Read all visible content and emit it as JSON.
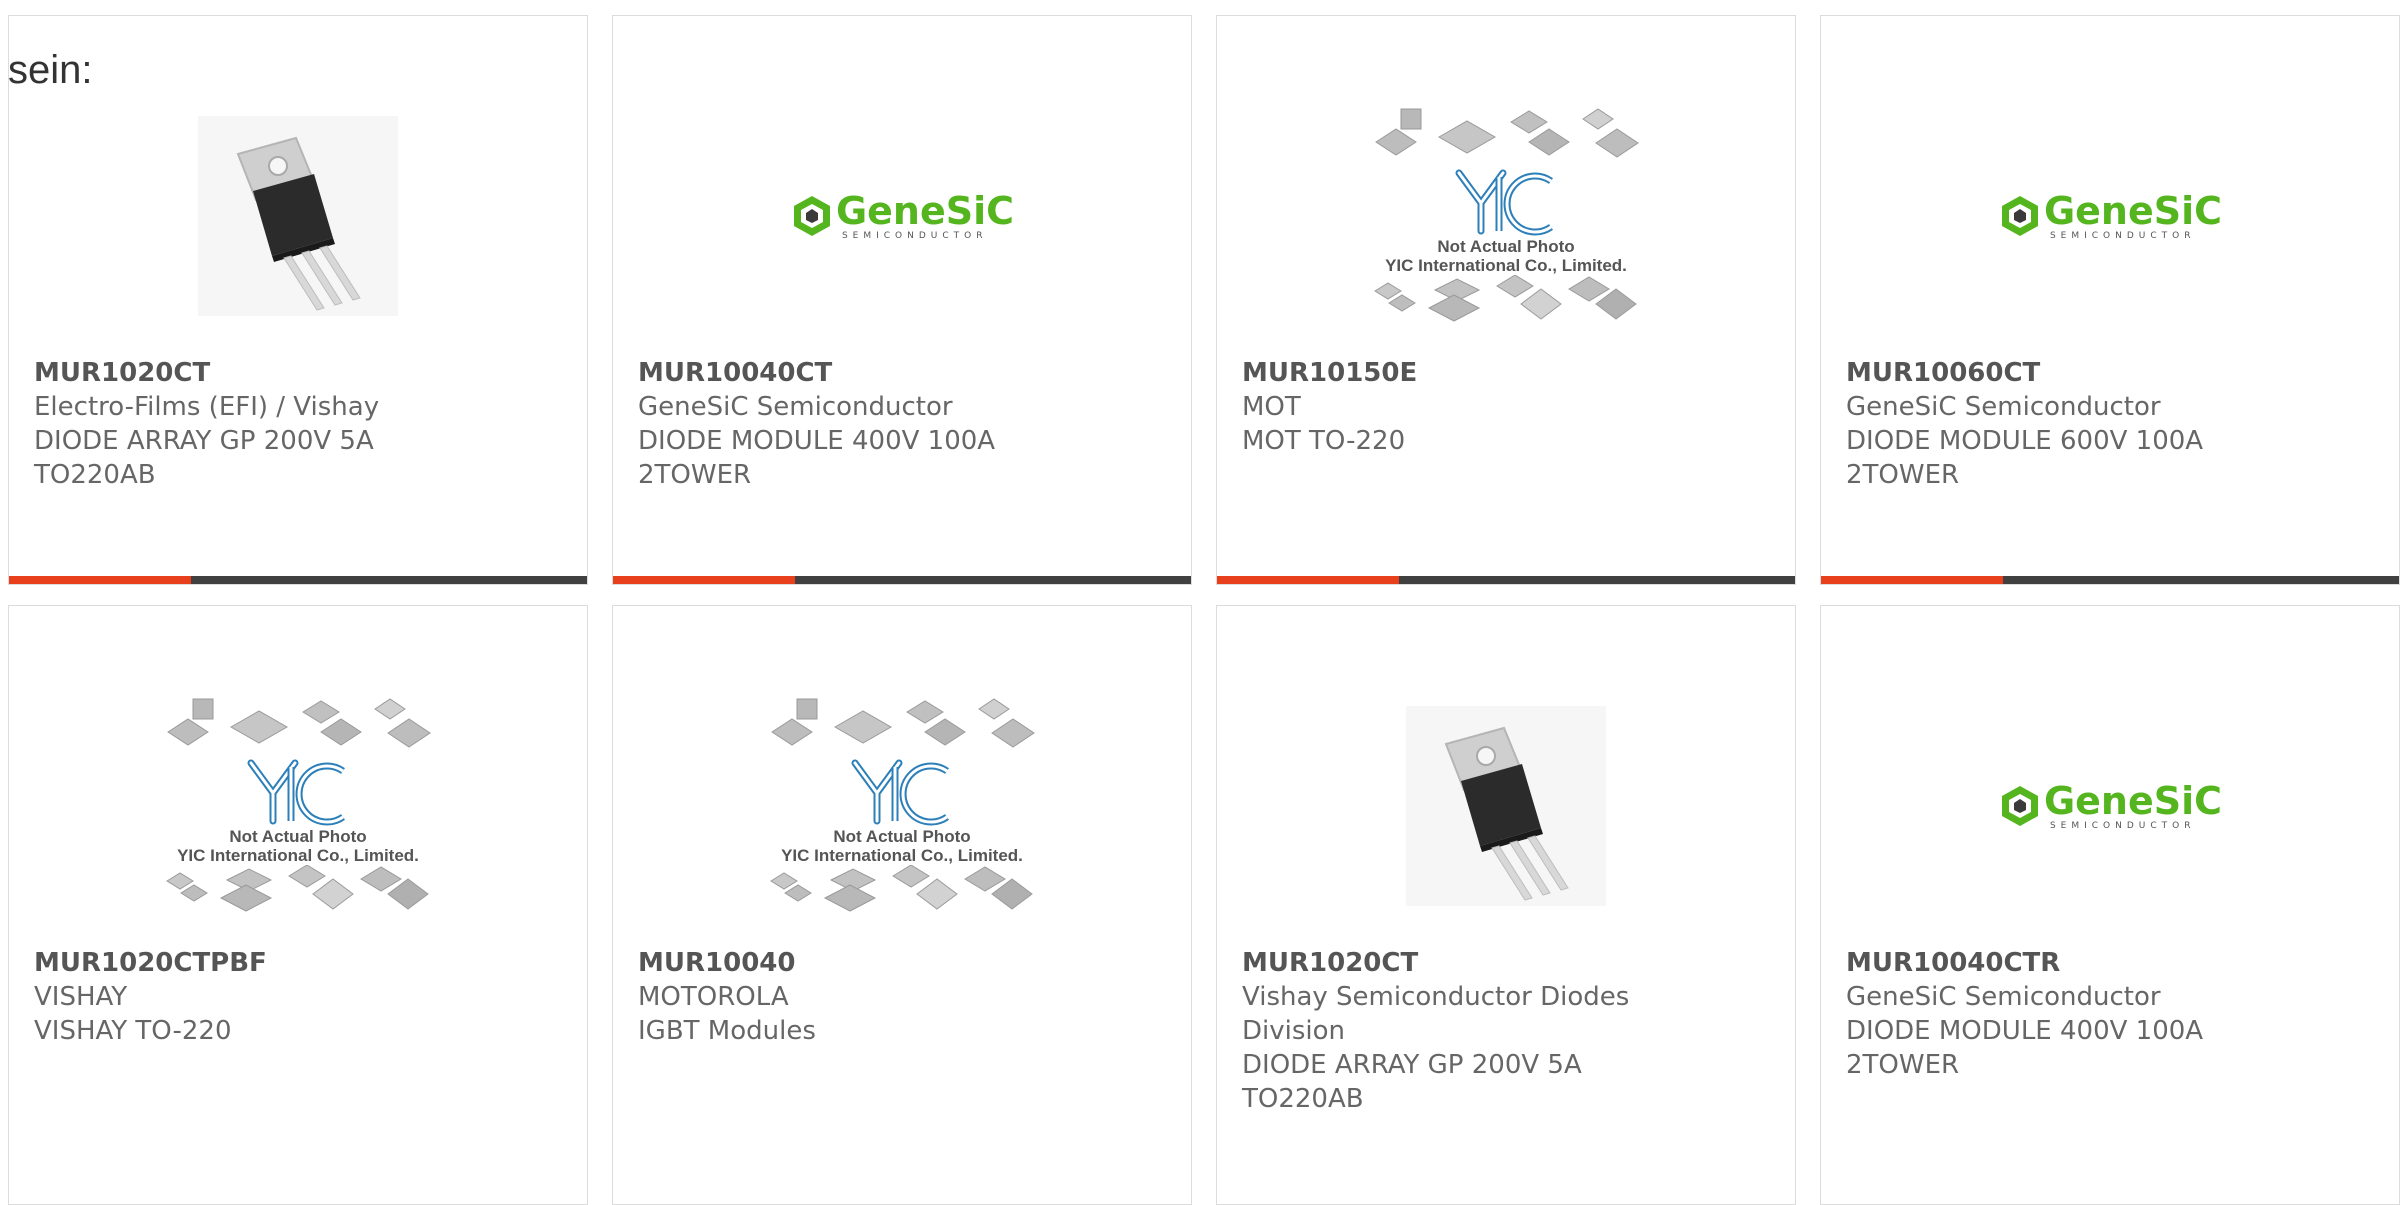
{
  "intro_text": "sein:",
  "colors": {
    "accent": "#e8401c",
    "bar": "#404040",
    "genesic_green": "#55b51f",
    "yic_blue": "#2d7fb9"
  },
  "products": [
    {
      "part": "MUR1020CT",
      "lines": [
        "Electro-Films (EFI) / Vishay",
        "DIODE ARRAY GP 200V 5A",
        "TO220AB"
      ],
      "image": "to220-package-photo"
    },
    {
      "part": "MUR10040CT",
      "lines": [
        "GeneSiC Semiconductor",
        "DIODE MODULE 400V 100A",
        "2TOWER"
      ],
      "image": "genesic-logo"
    },
    {
      "part": "MUR10150E",
      "lines": [
        "MOT",
        "MOT TO-220"
      ],
      "image": "yic-placeholder"
    },
    {
      "part": "MUR10060CT",
      "lines": [
        "GeneSiC Semiconductor",
        "DIODE MODULE 600V 100A",
        "2TOWER"
      ],
      "image": "genesic-logo"
    },
    {
      "part": "MUR1020CTPBF",
      "lines": [
        "VISHAY",
        "VISHAY TO-220"
      ],
      "image": "yic-placeholder"
    },
    {
      "part": "MUR10040",
      "lines": [
        "MOTOROLA",
        "IGBT Modules"
      ],
      "image": "yic-placeholder"
    },
    {
      "part": "MUR1020CT",
      "lines": [
        "Vishay Semiconductor Diodes",
        "Division",
        "DIODE ARRAY GP 200V 5A",
        "TO220AB"
      ],
      "image": "to220-package-photo"
    },
    {
      "part": "MUR10040CTR",
      "lines": [
        "GeneSiC Semiconductor",
        "DIODE MODULE 400V 100A",
        "2TOWER"
      ],
      "image": "genesic-logo"
    }
  ],
  "image_text": {
    "genesic_name": "GeneSiC",
    "genesic_sub": "SEMICONDUCTOR",
    "yic_line1": "Not Actual Photo",
    "yic_line2": "YIC International Co., Limited."
  }
}
